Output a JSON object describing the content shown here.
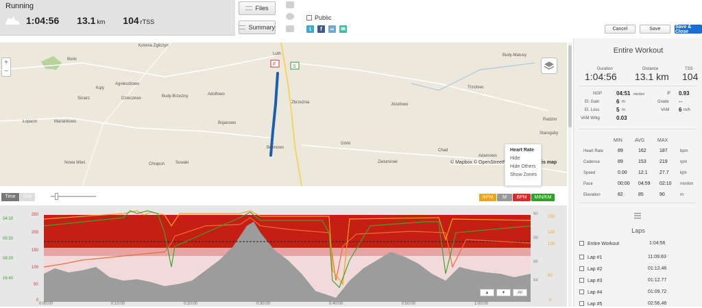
{
  "header": {
    "activity": "Running",
    "duration": "1:04:56",
    "distance": "13.1",
    "distance_unit": "km",
    "tss": "104",
    "tss_unit": "rTSS"
  },
  "buttons": {
    "files": "Files",
    "summary": "Summary",
    "cancel": "Cancel",
    "save": "Save",
    "save_close": "Save & Close"
  },
  "share": {
    "public_label": "Public",
    "icons": [
      "twitter-icon",
      "facebook-icon",
      "link-icon",
      "email-icon"
    ]
  },
  "map": {
    "attribution": "© Mapbox © OpenStreetMap",
    "improve": "is map",
    "start_marker": "S",
    "finish_marker": "F",
    "labels": [
      "Kolonia Zgliczyn",
      "Borki",
      "Kąty",
      "Agnieszkowo",
      "Siciarz",
      "Dzieczewo",
      "Budy-Brzeziny",
      "Adolfowo",
      "Łopacin",
      "Mariankowo",
      "Bojanowo",
      "Zbrzeżnia",
      "Bębnowo",
      "Górki",
      "Nowa Wieś",
      "Chrapoń",
      "Suwaki",
      "Zieluminek",
      "Chad",
      "Adamowo",
      "Józefowo",
      "Trzciniec",
      "Budy-Matusy",
      "Radzim",
      "Staroguby",
      "Luth"
    ]
  },
  "context_menu": {
    "title": "Heart Rate",
    "items": [
      "Hide",
      "Hide Others",
      "Show Zones"
    ]
  },
  "chart_controls": {
    "time": "Time",
    "dist": "Dist",
    "tags": [
      {
        "label": "RPM",
        "color": "#f0a21a"
      },
      {
        "label": "M",
        "color": "#999999"
      },
      {
        "label": "BPM",
        "color": "#d92b2b"
      },
      {
        "label": "MIN/KM",
        "color": "#2ea025"
      }
    ],
    "nav": [
      "▲",
      "▼",
      "All"
    ]
  },
  "chart_data": {
    "type": "line",
    "x_ticks": [
      "0:00:00",
      "0:10:00",
      "0:20:00",
      "0:30:00",
      "0:40:00",
      "0:50:00",
      "1:00:00"
    ],
    "left_pace_ticks": [
      "34:10",
      "05:33",
      "08:20",
      "16:40",
      ""
    ],
    "left_hr_ticks": [
      "250",
      "200",
      "150",
      "100",
      "50",
      "0"
    ],
    "right_elev_ticks": [
      "90",
      "88",
      "86",
      "84"
    ],
    "right_cad_ticks": [
      "150",
      "120",
      "100",
      "50",
      "0"
    ],
    "series": [
      {
        "name": "BPM",
        "color": "#d92b2b"
      },
      {
        "name": "RPM",
        "color": "#f0a21a"
      },
      {
        "name": "MIN/KM",
        "color": "#2ea025"
      },
      {
        "name": "M",
        "color": "#999999"
      }
    ]
  },
  "panel": {
    "title": "Entire Workout",
    "summary": [
      {
        "label": "Duration",
        "value": "1:04:56"
      },
      {
        "label": "Distance",
        "value": "13.1 km"
      },
      {
        "label": "TSS",
        "value": "104"
      }
    ],
    "metrics_left": [
      {
        "label": "NGP",
        "value": "04:51",
        "unit": "min/km"
      },
      {
        "label": "El. Gain",
        "value": "6",
        "unit": "m"
      },
      {
        "label": "El. Loss",
        "value": "5",
        "unit": "m"
      },
      {
        "label": "VAM W/kg",
        "value": "0.03",
        "unit": ""
      }
    ],
    "metrics_right": [
      {
        "label": "IF",
        "value": "0.93",
        "unit": ""
      },
      {
        "label": "Grade",
        "value": "--",
        "unit": ""
      },
      {
        "label": "VAM",
        "value": "6",
        "unit": "m/h"
      }
    ],
    "table_headers": [
      "MIN",
      "AVG",
      "MAX"
    ],
    "table_rows": [
      {
        "label": "Heart Rate",
        "min": "89",
        "avg": "162",
        "max": "187",
        "unit": "bpm"
      },
      {
        "label": "Cadence",
        "min": "89",
        "avg": "153",
        "max": "219",
        "unit": "rpm"
      },
      {
        "label": "Speed",
        "min": "0.00",
        "avg": "12.1",
        "max": "27.7",
        "unit": "kph"
      },
      {
        "label": "Pace",
        "min": "00:00",
        "avg": "04:59",
        "max": "02:10",
        "unit": "min/km"
      },
      {
        "label": "Elevation",
        "min": "82",
        "avg": "85",
        "max": "90",
        "unit": "m"
      }
    ],
    "laps_title": "Laps",
    "laps": [
      {
        "name": "Entire Workout",
        "time": "1:04:56"
      },
      {
        "name": "Lap #1",
        "time": "11:09.83"
      },
      {
        "name": "Lap #2",
        "time": "01:12.46"
      },
      {
        "name": "Lap #3",
        "time": "01:12.77"
      },
      {
        "name": "Lap #4",
        "time": "01:09.72"
      },
      {
        "name": "Lap #5",
        "time": "02:56.46"
      }
    ]
  }
}
